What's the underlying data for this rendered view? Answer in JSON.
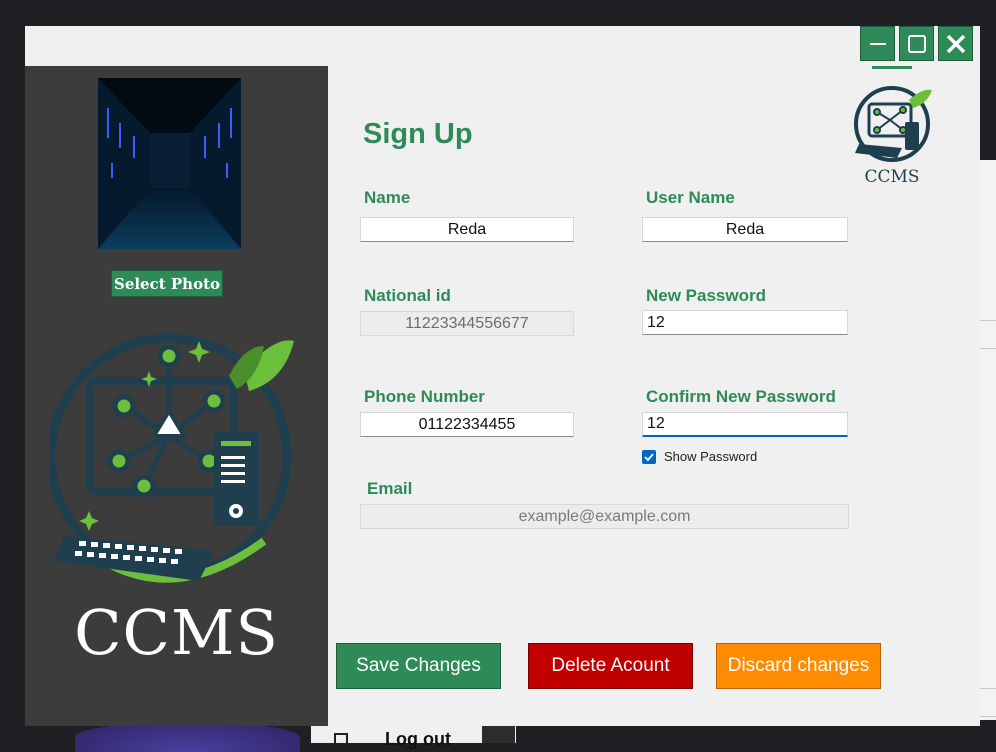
{
  "window": {
    "title": "Sign Up",
    "controls": {
      "minimize": "minimize",
      "maximize": "maximize",
      "close": "close"
    }
  },
  "sidebar": {
    "select_photo_label": "Select Photo",
    "brand": "CCMS"
  },
  "header": {
    "brand": "CCMS"
  },
  "form": {
    "name": {
      "label": "Name",
      "value": "Reda"
    },
    "username": {
      "label": "User Name",
      "value": "Reda"
    },
    "national_id": {
      "label": "National id",
      "value": "11223344556677"
    },
    "new_password": {
      "label": "New Password",
      "value": "12"
    },
    "phone": {
      "label": "Phone Number",
      "value": "01122334455"
    },
    "confirm_password": {
      "label": "Confirm New Password",
      "value": "12"
    },
    "show_password": {
      "label": "Show Password",
      "checked": true
    },
    "email": {
      "label": "Email",
      "value": "",
      "placeholder": "example@example.com"
    }
  },
  "actions": {
    "save": "Save Changes",
    "delete": "Delete Acount",
    "discard": "Discard changes"
  },
  "background": {
    "logout_label": "Log out"
  },
  "colors": {
    "accent": "#2e8b57",
    "danger": "#c00000",
    "warning": "#ff8c00",
    "sidebar": "#3c3c3c",
    "focus": "#0067c0"
  }
}
